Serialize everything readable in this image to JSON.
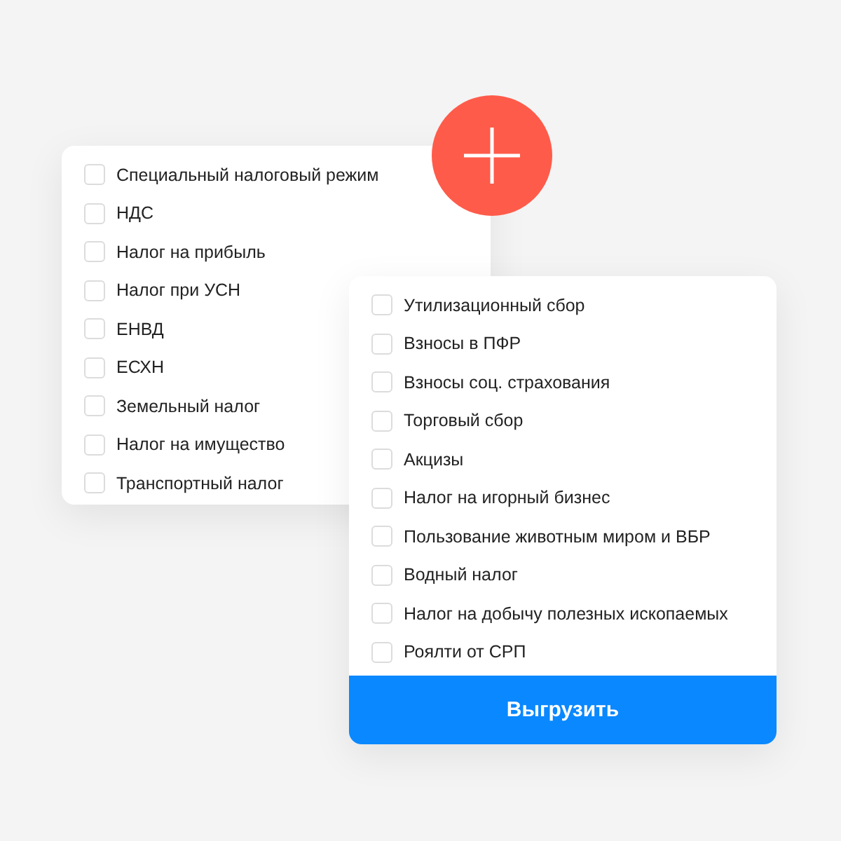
{
  "left_list": {
    "items": [
      {
        "label": "Специальный налоговый режим",
        "checked": false
      },
      {
        "label": "НДС",
        "checked": false
      },
      {
        "label": "Налог на прибыль",
        "checked": false
      },
      {
        "label": "Налог при УСН",
        "checked": false
      },
      {
        "label": "ЕНВД",
        "checked": false
      },
      {
        "label": "ЕСХН",
        "checked": false
      },
      {
        "label": "Земельный налог",
        "checked": false
      },
      {
        "label": "Налог на имущество",
        "checked": false
      },
      {
        "label": "Транспортный налог",
        "checked": false
      }
    ]
  },
  "right_list": {
    "items": [
      {
        "label": "Утилизационный сбор",
        "checked": false
      },
      {
        "label": "Взносы в ПФР",
        "checked": false
      },
      {
        "label": "Взносы соц. страхования",
        "checked": false
      },
      {
        "label": "Торговый сбор",
        "checked": false
      },
      {
        "label": "Акцизы",
        "checked": false
      },
      {
        "label": "Налог на игорный бизнес",
        "checked": false
      },
      {
        "label": "Пользование животным миром и ВБР",
        "checked": false
      },
      {
        "label": "Водный налог",
        "checked": false
      },
      {
        "label": "Налог на добычу полезных ископаемых",
        "checked": false
      },
      {
        "label": "Роялти от СРП",
        "checked": false
      }
    ],
    "button": "Выгрузить"
  }
}
